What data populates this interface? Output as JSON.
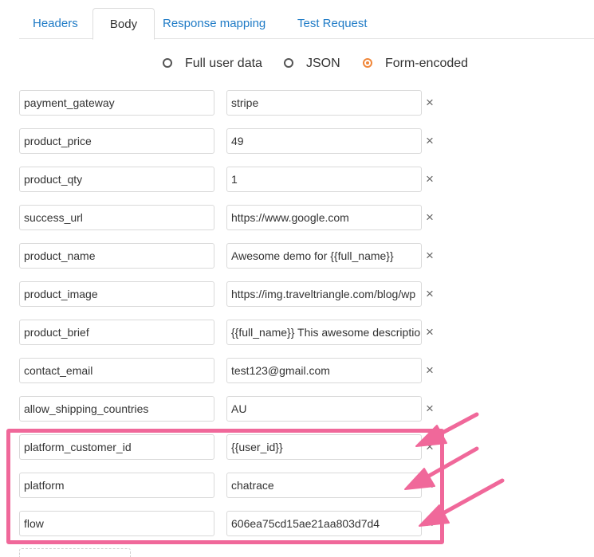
{
  "tabs": [
    {
      "label": "Headers",
      "active": false
    },
    {
      "label": "Body",
      "active": true
    },
    {
      "label": "Response mapping",
      "active": false
    },
    {
      "label": "Test Request",
      "active": false
    }
  ],
  "body_type": {
    "options": [
      {
        "label": "Full user data",
        "checked": false
      },
      {
        "label": "JSON",
        "checked": false
      },
      {
        "label": "Form-encoded",
        "checked": true
      }
    ]
  },
  "form_fields": [
    {
      "key": "payment_gateway",
      "value": "stripe"
    },
    {
      "key": "product_price",
      "value": "49"
    },
    {
      "key": "product_qty",
      "value": "1"
    },
    {
      "key": "success_url",
      "value": "https://www.google.com"
    },
    {
      "key": "product_name",
      "value": "Awesome demo for {{full_name}}"
    },
    {
      "key": "product_image",
      "value": "https://img.traveltriangle.com/blog/wp"
    },
    {
      "key": "product_brief",
      "value": "{{full_name}} This awesome description"
    },
    {
      "key": "contact_email",
      "value": "test123@gmail.com"
    },
    {
      "key": "allow_shipping_countries",
      "value": "AU"
    },
    {
      "key": "platform_customer_id",
      "value": "{{user_id}}"
    },
    {
      "key": "platform",
      "value": "chatrace"
    },
    {
      "key": "flow",
      "value": "606ea75cd15ae21aa803d7d4"
    }
  ],
  "remove_glyph": "×",
  "colors": {
    "tab_link": "#1f7bc6",
    "radio_accent": "#f0873a",
    "annotation": "#f0689a"
  }
}
